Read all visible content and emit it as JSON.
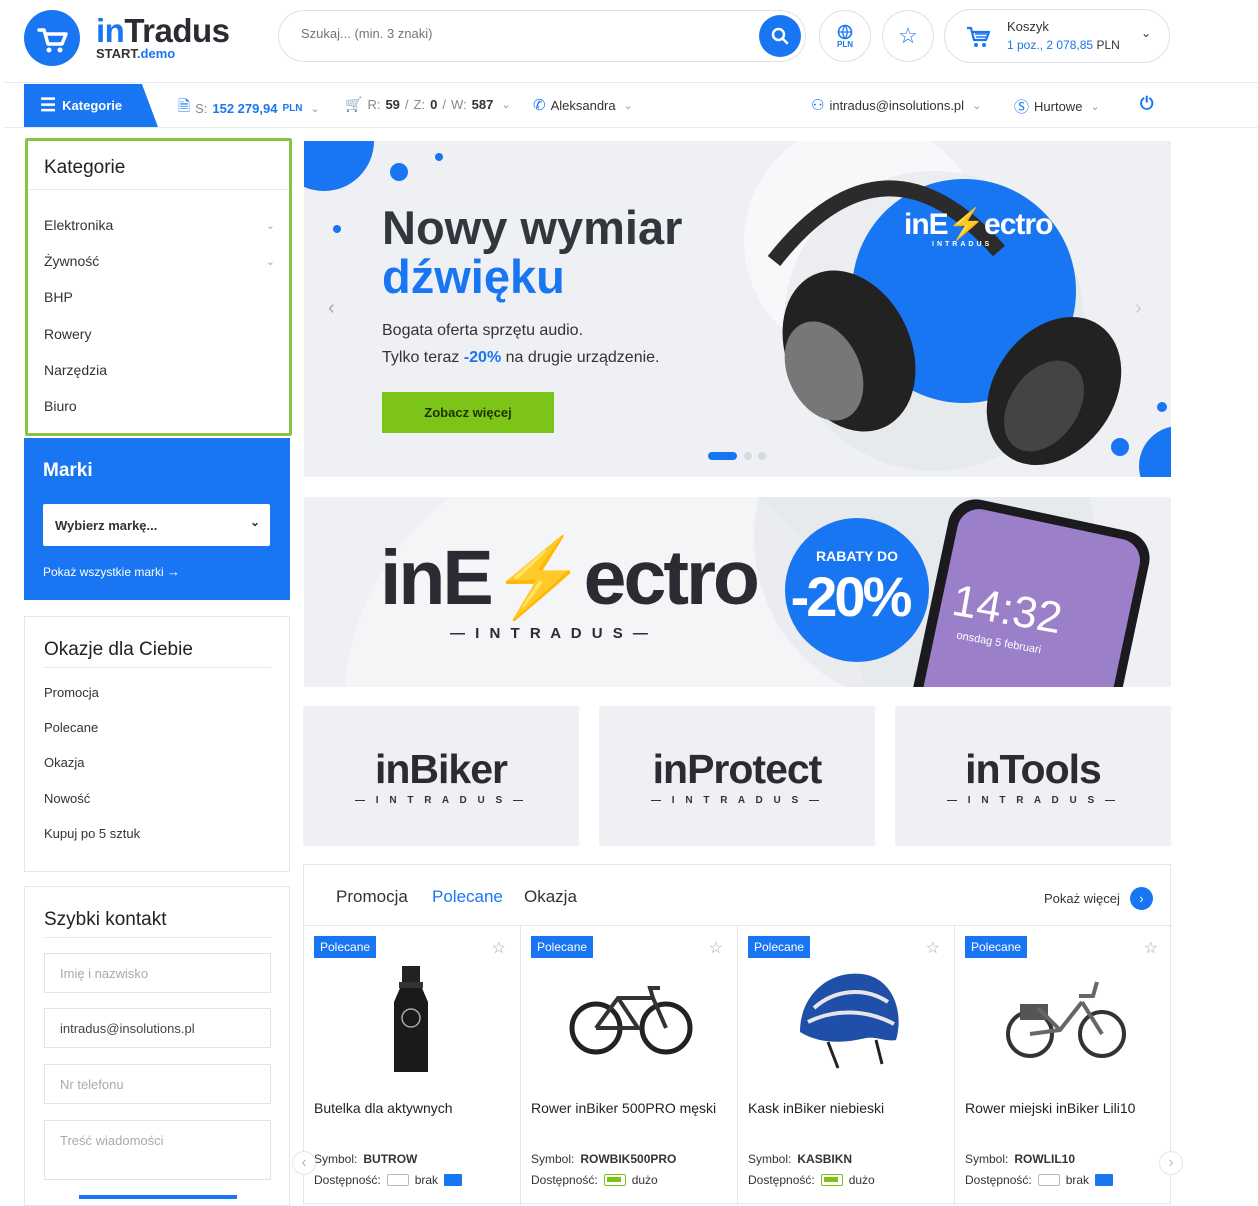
{
  "logo": {
    "name_part1": "in",
    "name_part2": "Tradus",
    "sub_part1": "START",
    "sub_part2": ".demo"
  },
  "search": {
    "placeholder": "Szukaj... (min. 3 znaki)"
  },
  "currency_label": "PLN",
  "cart": {
    "title": "Koszyk",
    "count": "1 poz.,",
    "amount": "2 078,85",
    "currency": "PLN"
  },
  "nav": {
    "categories": "Kategorie",
    "balance_prefix": "S:",
    "balance_value": "152 279,94",
    "balance_currency": "PLN",
    "orders_r_label": "R:",
    "orders_r": "59",
    "orders_z_label": "Z:",
    "orders_z": "0",
    "orders_w_label": "W:",
    "orders_w": "587",
    "contact_person": "Aleksandra",
    "user_email": "intradus@insolutions.pl",
    "price_mode": "Hurtowe"
  },
  "sidebar": {
    "categories_title": "Kategorie",
    "categories": [
      "Elektronika",
      "Żywność",
      "BHP",
      "Rowery",
      "Narzędzia",
      "Biuro"
    ],
    "brands_title": "Marki",
    "brands_select": "Wybierz markę...",
    "brands_link": "Pokaż wszystkie marki",
    "deals_title": "Okazje dla Ciebie",
    "deals": [
      "Promocja",
      "Polecane",
      "Okazja",
      "Nowość",
      "Kupuj po 5 sztuk"
    ],
    "contact_title": "Szybki kontakt",
    "contact_name_placeholder": "Imię i nazwisko",
    "contact_email_value": "intradus@insolutions.pl",
    "contact_phone_placeholder": "Nr telefonu",
    "contact_message_placeholder": "Treść wiadomości"
  },
  "hero": {
    "title_line1": "Nowy wymiar",
    "title_line2": "dźwięku",
    "text_line1": "Bogata oferta sprzętu audio.",
    "text_line2_a": "Tylko teraz ",
    "text_line2_b": "-20%",
    "text_line2_c": " na drugie urządzenie.",
    "button": "Zobacz więcej",
    "brand_logo_a": "inE",
    "brand_logo_b": "ectro",
    "brand_logo_sub": "INTRADUS"
  },
  "banner2": {
    "logo_a": "inE",
    "logo_b": "ectro",
    "logo_sub": "— I N T R A D U S —",
    "badge_top": "RABATY DO",
    "badge_value": "-20%",
    "phone_time": "14:32",
    "phone_date": "onsdag 5 februari"
  },
  "brands": [
    {
      "name": "inBiker",
      "sub": "— I N T R A D U S —"
    },
    {
      "name": "inProtect",
      "sub": "— I N T R A D U S —"
    },
    {
      "name": "inTools",
      "sub": "— I N T R A D U S —"
    }
  ],
  "products": {
    "tabs": [
      "Promocja",
      "Polecane",
      "Okazja"
    ],
    "show_more": "Pokaż więcej",
    "symbol_label": "Symbol:",
    "availability_label": "Dostępność:",
    "items": [
      {
        "tag": "Polecane",
        "name": "Butelka dla aktywnych",
        "symbol": "BUTROW",
        "availability": "brak"
      },
      {
        "tag": "Polecane",
        "name": "Rower inBiker 500PRO męski",
        "symbol": "ROWBIK500PRO",
        "availability": "dużo"
      },
      {
        "tag": "Polecane",
        "name": "Kask inBiker niebieski",
        "symbol": "KASBIKN",
        "availability": "dużo"
      },
      {
        "tag": "Polecane",
        "name": "Rower miejski inBiker Lili10",
        "symbol": "ROWLIL10",
        "availability": "brak"
      }
    ]
  },
  "colors": {
    "accent": "#1976f2",
    "green": "#7cc418",
    "highlight_border": "#8bc34a"
  }
}
